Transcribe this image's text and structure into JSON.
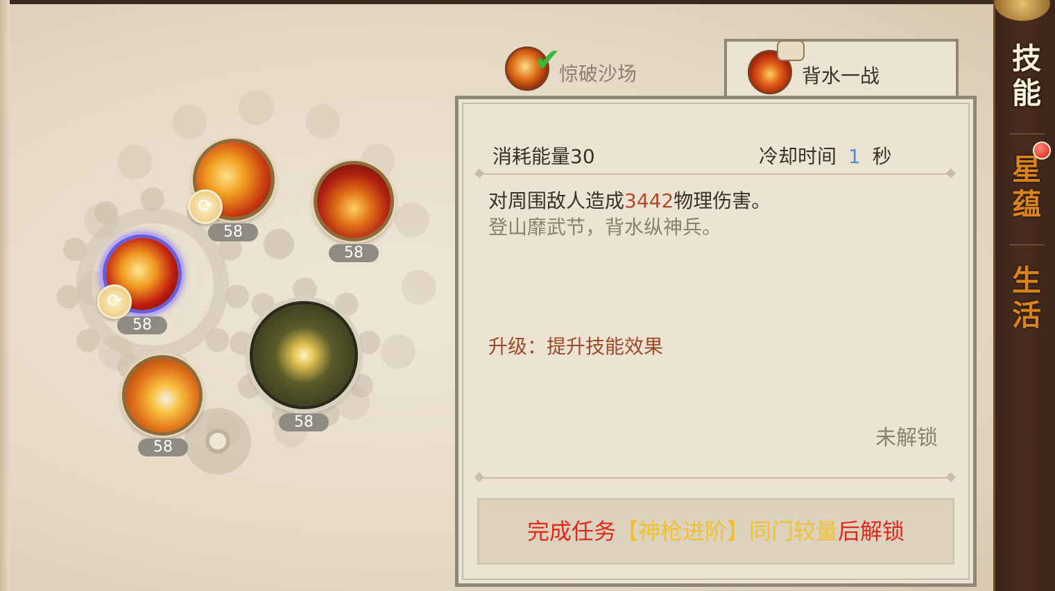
{
  "tabs": [
    {
      "label": "惊破沙场",
      "state": "completed",
      "active": false
    },
    {
      "label": "背水一战",
      "state": "locked",
      "active": true
    }
  ],
  "skill_detail": {
    "energy_cost": "消耗能量30",
    "cooldown_label": "冷却时间",
    "cooldown_value": "1",
    "cooldown_unit": "秒",
    "desc_prefix": "对周围敌人造成",
    "desc_damage": "3442",
    "desc_suffix": "物理伤害。",
    "flavor": "登山靡武节，背水纵神兵。",
    "upgrade_text": "升级：提升技能效果",
    "lock_status": "未解锁",
    "unlock_prefix": "完成任务",
    "unlock_quest": "【神枪进阶】同门较量",
    "unlock_suffix": "后解锁"
  },
  "skills": [
    {
      "level": "58",
      "has_swap": true
    },
    {
      "level": "58",
      "has_swap": false
    },
    {
      "level": "58",
      "has_swap": true,
      "selected": true
    },
    {
      "level": "58",
      "has_swap": false
    },
    {
      "level": "58",
      "has_swap": false
    }
  ],
  "sidebar": {
    "items": [
      {
        "label": "技能",
        "active": true
      },
      {
        "label": "星蕴",
        "active": false,
        "has_notification": true
      },
      {
        "label": "生活",
        "active": false
      }
    ]
  },
  "colors": {
    "damage_highlight": "#b04a2a",
    "cooldown_value": "#4a90d8",
    "unlock_red": "#e0281a",
    "unlock_quest": "#f0c030",
    "upgrade_text": "#9a4a2a"
  }
}
